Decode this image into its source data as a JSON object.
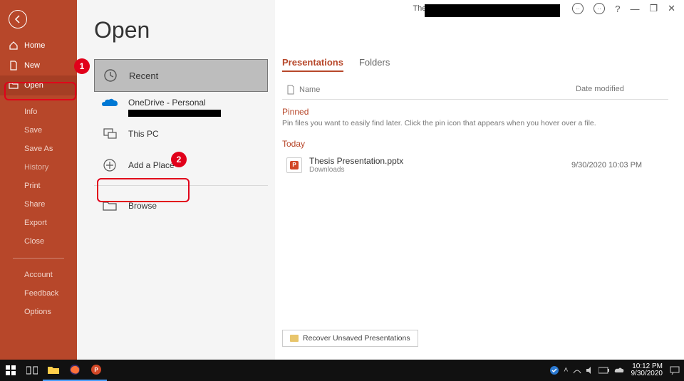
{
  "titlebar": "Thesis Presentation.pptx  -  PowerPoint",
  "page_title": "Open",
  "sidebar": {
    "home": "Home",
    "new": "New",
    "open": "Open",
    "info": "Info",
    "save": "Save",
    "save_as": "Save As",
    "history": "History",
    "print": "Print",
    "share": "Share",
    "export": "Export",
    "close": "Close",
    "account": "Account",
    "feedback": "Feedback",
    "options": "Options"
  },
  "sources": {
    "recent": "Recent",
    "onedrive": "OneDrive - Personal",
    "this_pc": "This PC",
    "add_place": "Add a Place",
    "browse": "Browse"
  },
  "tabs": {
    "presentations": "Presentations",
    "folders": "Folders"
  },
  "headers": {
    "name": "Name",
    "date": "Date modified"
  },
  "pinned": {
    "label": "Pinned",
    "hint": "Pin files you want to easily find later. Click the pin icon that appears when you hover over a file."
  },
  "today": {
    "label": "Today"
  },
  "files": [
    {
      "name": "Thesis Presentation.pptx",
      "location": "Downloads",
      "date": "9/30/2020 10:03 PM"
    }
  ],
  "recover": "Recover Unsaved Presentations",
  "annotations": {
    "badge1": "1",
    "badge2": "2"
  },
  "systray": {
    "time": "10:12 PM",
    "date": "9/30/2020"
  }
}
